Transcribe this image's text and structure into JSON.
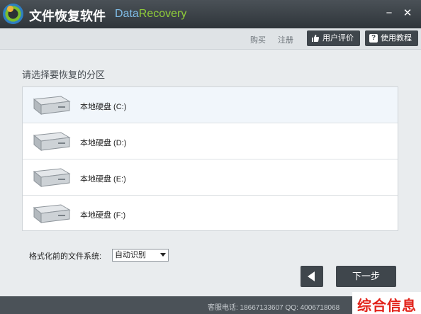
{
  "window": {
    "title_cn": "文件恢复软件",
    "title_en_data": "Data",
    "title_en_recovery": "Recovery",
    "minimize_glyph": "−",
    "close_glyph": "✕"
  },
  "toolbar": {
    "buy": "购买",
    "register": "注册",
    "review": "用户评价",
    "review_icon": "thumbs-up-icon",
    "tutorial": "使用教程",
    "tutorial_icon": "help-icon"
  },
  "main": {
    "prompt": "请选择要恢复的分区",
    "drives": [
      {
        "label": "本地硬盘  (C:)",
        "selected": true
      },
      {
        "label": "本地硬盘  (D:)",
        "selected": false
      },
      {
        "label": "本地硬盘  (E:)",
        "selected": false
      },
      {
        "label": "本地硬盘  (F:)",
        "selected": false
      }
    ],
    "fs_label": "格式化前的文件系统:",
    "fs_value": "自动识别",
    "back_icon": "back-arrow-icon",
    "next": "下一步"
  },
  "status": {
    "text": "客服电话: 18667133607   QQ: 4006718068"
  },
  "watermark": {
    "text": "综合信息"
  },
  "colors": {
    "titlebar": "#3a4045",
    "button_dark": "#3f464c",
    "accent_green": "#8fcc39",
    "accent_blue": "#7fbce6",
    "watermark_red": "#e2231a"
  }
}
